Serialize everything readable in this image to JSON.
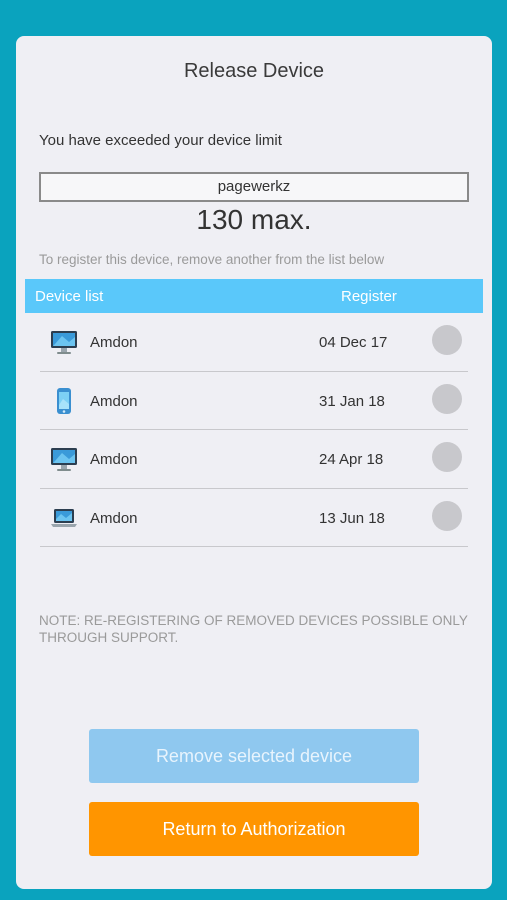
{
  "dialog": {
    "title": "Release Device",
    "exceeded_text": "You have exceeded your device limit",
    "account_name": "pagewerkz",
    "max_text": "130 max.",
    "hint_text": "To register this device, remove another from the list below",
    "note_text": "NOTE: RE-REGISTERING OF REMOVED DEVICES POSSIBLE ONLY THROUGH SUPPORT."
  },
  "list": {
    "header_device": "Device list",
    "header_register": "Register",
    "rows": [
      {
        "name": "Amdon",
        "date": "04 Dec 17",
        "icon": "desktop-icon"
      },
      {
        "name": "Amdon",
        "date": "31 Jan 18",
        "icon": "phone-icon"
      },
      {
        "name": "Amdon",
        "date": "24 Apr 18",
        "icon": "desktop-icon"
      },
      {
        "name": "Amdon",
        "date": "13 Jun 18",
        "icon": "laptop-icon"
      }
    ]
  },
  "buttons": {
    "remove_label": "Remove selected device",
    "return_label": "Return to Authorization"
  },
  "colors": {
    "background": "#0aa3be",
    "header": "#5ac8fa",
    "remove_button": "#8fc8ef",
    "return_button": "#ff9500"
  }
}
